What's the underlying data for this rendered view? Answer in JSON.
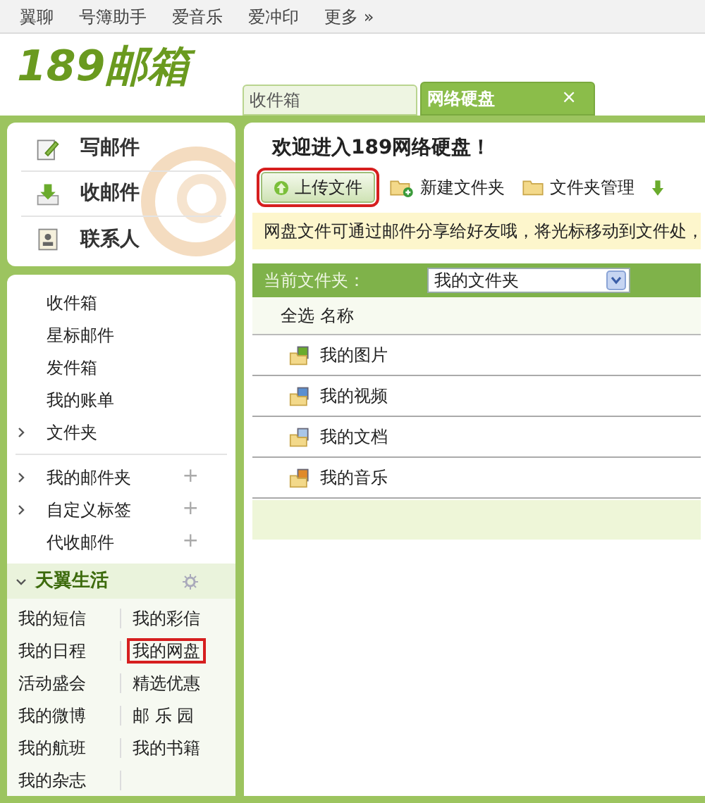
{
  "top_nav": [
    "翼聊",
    "号簿助手",
    "爱音乐",
    "爱冲印",
    "更多 »"
  ],
  "logo": "189邮箱",
  "tabs": [
    {
      "label": "收件箱",
      "selected": false,
      "closable": false
    },
    {
      "label": "网络硬盘",
      "selected": true,
      "closable": true,
      "close_glyph": "×"
    }
  ],
  "quick_actions": [
    {
      "kind": "compose",
      "label": "写邮件"
    },
    {
      "kind": "receive",
      "label": "收邮件"
    },
    {
      "kind": "contacts",
      "label": "联系人"
    }
  ],
  "mail_folders": [
    {
      "label": "收件箱",
      "expandable": false
    },
    {
      "label": "星标邮件",
      "expandable": false
    },
    {
      "label": "发件箱",
      "expandable": false
    },
    {
      "label": "我的账单",
      "expandable": false
    },
    {
      "label": "文件夹",
      "expandable": true
    }
  ],
  "custom_sections": [
    {
      "label": "我的邮件夹",
      "expandable": true,
      "add_glyph": "+"
    },
    {
      "label": "自定义标签",
      "expandable": true,
      "add_glyph": "+"
    },
    {
      "label": "代收邮件",
      "expandable": false,
      "add_glyph": "+"
    }
  ],
  "life": {
    "title": "天翼生活",
    "expanded": true,
    "items": [
      {
        "label": "我的短信",
        "highlighted": false
      },
      {
        "label": "我的彩信",
        "highlighted": false
      },
      {
        "label": "我的日程",
        "highlighted": false
      },
      {
        "label": "我的网盘",
        "highlighted": true
      },
      {
        "label": "活动盛会",
        "highlighted": false
      },
      {
        "label": "精选优惠",
        "highlighted": false
      },
      {
        "label": "我的微博",
        "highlighted": false
      },
      {
        "label": "邮 乐 园",
        "highlighted": false
      },
      {
        "label": "我的航班",
        "highlighted": false
      },
      {
        "label": "我的书籍",
        "highlighted": false
      },
      {
        "label": "我的杂志",
        "highlighted": false
      }
    ]
  },
  "disk": {
    "welcome": "欢迎进入189网络硬盘！",
    "toolbar": [
      {
        "kind": "upload",
        "label": "上传文件",
        "highlighted": true
      },
      {
        "kind": "new_folder",
        "label": "新建文件夹",
        "highlighted": false
      },
      {
        "kind": "manage",
        "label": "文件夹管理",
        "highlighted": false
      },
      {
        "kind": "download",
        "highlighted": false
      }
    ],
    "notice": "网盘文件可通过邮件分享给好友哦，将光标移动到文件处，",
    "current_folder_label": "当前文件夹：",
    "current_folder": "我的文件夹",
    "columns": [
      "全选",
      "名称"
    ],
    "files": [
      {
        "kind": "pictures",
        "name": "我的图片"
      },
      {
        "kind": "videos",
        "name": "我的视频"
      },
      {
        "kind": "documents",
        "name": "我的文档"
      },
      {
        "kind": "music",
        "name": "我的音乐"
      }
    ]
  }
}
